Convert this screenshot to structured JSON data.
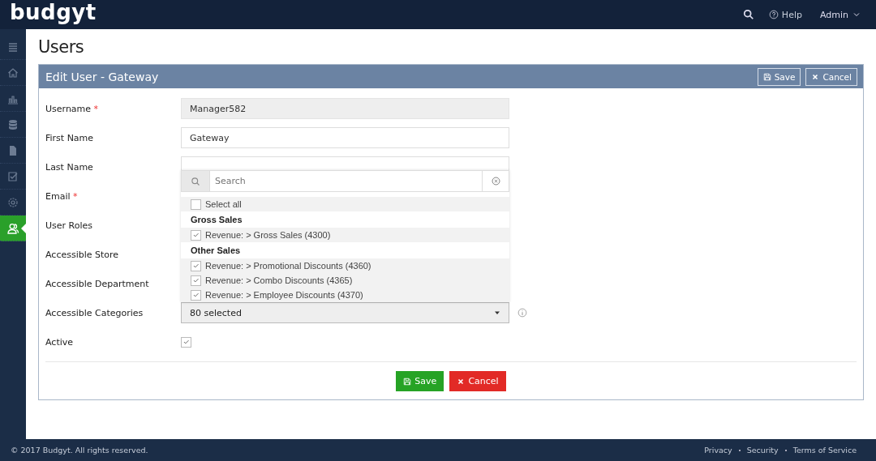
{
  "top_bar": {
    "logo": "budgyt",
    "help": "Help",
    "user_menu": "Admin"
  },
  "sidebar": {
    "items": [
      {
        "kind": "menu",
        "selected": false
      },
      {
        "kind": "home",
        "selected": false
      },
      {
        "kind": "chart",
        "selected": false
      },
      {
        "kind": "database",
        "selected": false
      },
      {
        "kind": "document",
        "selected": false
      },
      {
        "kind": "checklist",
        "selected": false
      },
      {
        "kind": "settings",
        "selected": false
      },
      {
        "kind": "users",
        "selected": true
      }
    ]
  },
  "page_title": "Users",
  "panel": {
    "title": "Edit User - Gateway",
    "header_buttons": [
      {
        "kind": "save",
        "label": "Save"
      },
      {
        "kind": "cancel",
        "label": "Cancel"
      }
    ],
    "rows": [
      {
        "label": "Username",
        "required_mark": "*",
        "kind": "readonly",
        "value": "Manager582"
      },
      {
        "label": "First Name",
        "kind": "text",
        "value": "Gateway"
      },
      {
        "label": "Last Name",
        "kind": "text"
      },
      {
        "label": "Email",
        "required_mark": "*",
        "kind": "covered"
      },
      {
        "label": "User Roles",
        "kind": "covered"
      },
      {
        "label": "Accessible Store",
        "kind": "covered"
      },
      {
        "label": "Accessible Department",
        "kind": "covered"
      },
      {
        "label": "Accessible Categories",
        "kind": "multiselect",
        "value": "80 selected"
      },
      {
        "label": "Active",
        "kind": "checkbox",
        "checked": true
      }
    ],
    "dropdown": {
      "expanded": true,
      "search_placeholder": "Search",
      "select_all": {
        "label": "Select all",
        "checked": false
      },
      "groups": [
        {
          "title": "Gross Sales",
          "options": [
            {
              "label": "Revenue: > Gross Sales (4300)",
              "checked": true
            }
          ]
        },
        {
          "title": "Other Sales",
          "options": [
            {
              "label": "Revenue: > Promotional Discounts (4360)",
              "checked": true
            },
            {
              "label": "Revenue: > Combo Discounts (4365)",
              "checked": true
            },
            {
              "label": "Revenue: > Employee Discounts (4370)",
              "checked": true
            }
          ]
        }
      ]
    },
    "footer_buttons": [
      {
        "kind": "save",
        "label": "Save"
      },
      {
        "kind": "cancel",
        "label": "Cancel"
      }
    ]
  },
  "footer": {
    "copyright": "© 2017 Budgyt. All rights reserved.",
    "links": [
      "Privacy",
      "Security",
      "Terms of Service"
    ]
  }
}
